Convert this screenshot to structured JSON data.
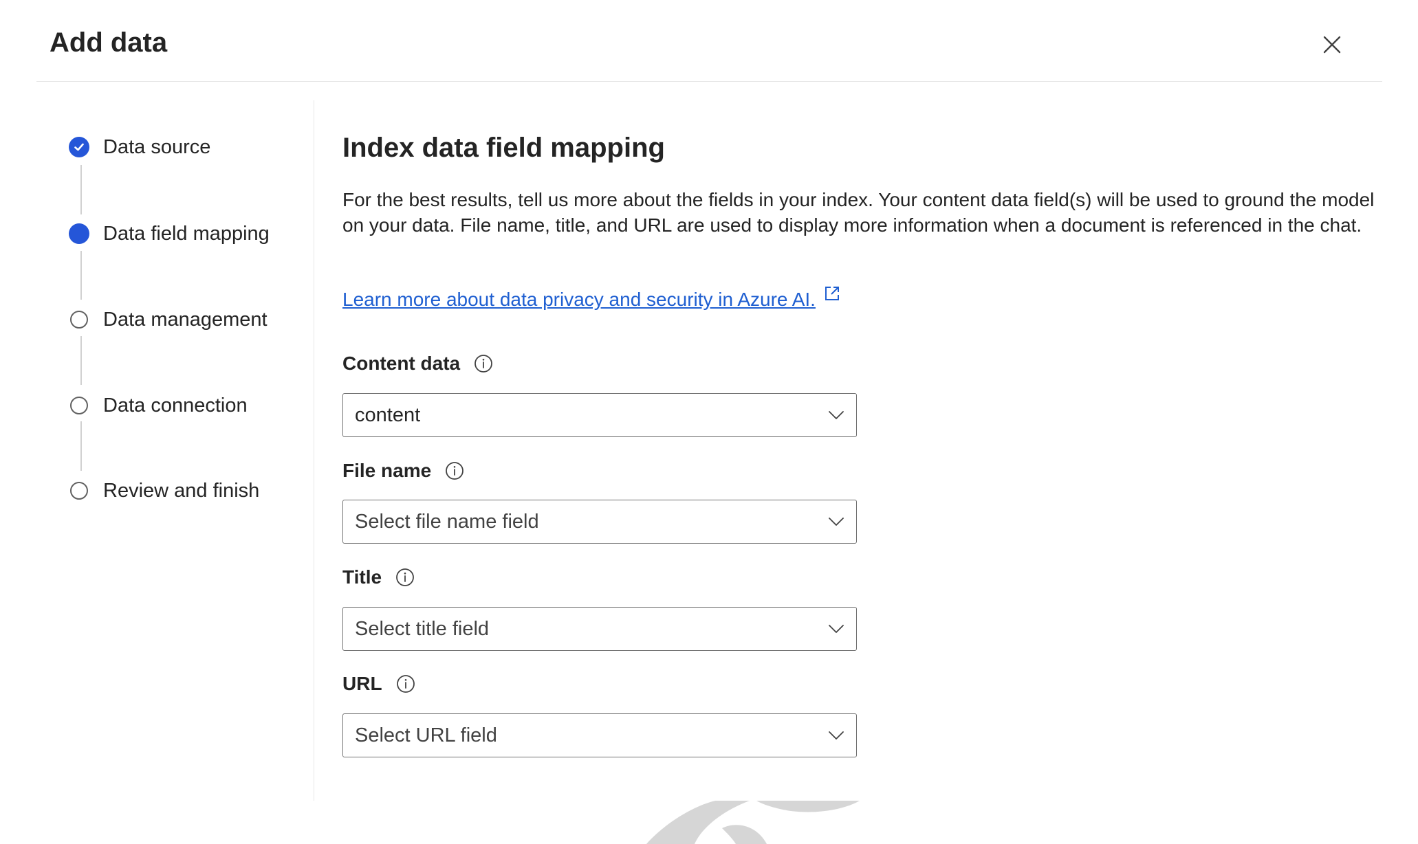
{
  "dialog": {
    "title": "Add data",
    "close_icon": "close-icon"
  },
  "steps": [
    {
      "label": "Data source",
      "state": "completed",
      "icon": "checkmark-circle-icon"
    },
    {
      "label": "Data field mapping",
      "state": "current",
      "icon": "filled-circle-icon"
    },
    {
      "label": "Data management",
      "state": "pending",
      "icon": "empty-circle-icon"
    },
    {
      "label": "Data connection",
      "state": "pending",
      "icon": "empty-circle-icon"
    },
    {
      "label": "Review and finish",
      "state": "pending",
      "icon": "empty-circle-icon"
    }
  ],
  "main": {
    "title": "Index data field mapping",
    "description": "For the best results, tell us more about the fields in your index. Your content data field(s) will be used to ground the model on your data. File name, title, and URL are used to display more information when a document is referenced in the chat.",
    "link_text": "Learn more about data privacy and security in Azure AI.",
    "link_icon": "open-external-icon"
  },
  "fields": [
    {
      "label": "Content data",
      "value": "content",
      "placeholder": "",
      "info_icon": "info-icon",
      "chevron_icon": "chevron-down-icon"
    },
    {
      "label": "File name",
      "value": "",
      "placeholder": "Select file name field",
      "info_icon": "info-icon",
      "chevron_icon": "chevron-down-icon"
    },
    {
      "label": "Title",
      "value": "",
      "placeholder": "Select title field",
      "info_icon": "info-icon",
      "chevron_icon": "chevron-down-icon"
    },
    {
      "label": "URL",
      "value": "",
      "placeholder": "Select URL field",
      "info_icon": "info-icon",
      "chevron_icon": "chevron-down-icon"
    }
  ],
  "colors": {
    "accent": "#2556d8",
    "link": "#1f5fd1",
    "text": "#242424",
    "border": "#707070",
    "divider": "#e6e6e6"
  }
}
